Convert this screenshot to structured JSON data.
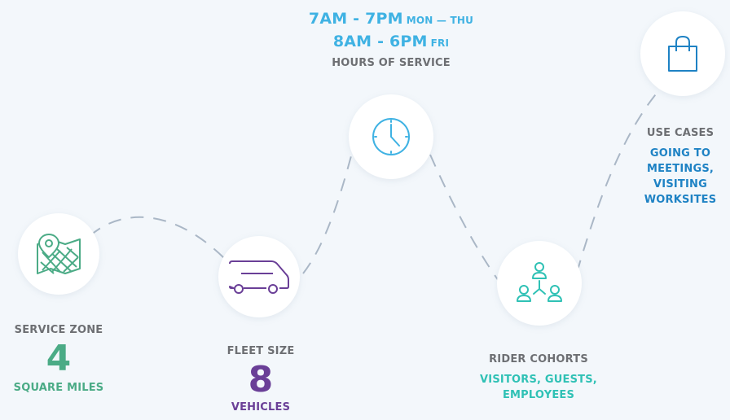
{
  "colors": {
    "path": "#aab7c6",
    "zone": "#4bab86",
    "fleet": "#6a3f97",
    "hours": "#3fb2e3",
    "cohorts": "#2fc1b5",
    "usecases": "#1e82c4",
    "caption": "#6d6f73"
  },
  "service_zone": {
    "icon": "map-pin-icon",
    "caption": "SERVICE ZONE",
    "value": "4",
    "unit": "SQUARE MILES"
  },
  "fleet_size": {
    "icon": "van-icon",
    "caption": "FLEET SIZE",
    "value": "8",
    "unit": "VEHICLES"
  },
  "hours_of_service": {
    "icon": "clock-icon",
    "line1_time": "7AM - 7PM",
    "line1_days": "MON — THU",
    "line2_time": "8AM - 6PM",
    "line2_days": "FRI",
    "caption": "HOURS OF SERVICE"
  },
  "rider_cohorts": {
    "icon": "people-network-icon",
    "caption": "RIDER COHORTS",
    "value_line1": "VISITORS, GUESTS,",
    "value_line2": "EMPLOYEES"
  },
  "use_cases": {
    "icon": "shopping-bag-icon",
    "caption": "USE CASES",
    "value_line1": "GOING TO",
    "value_line2": "MEETINGS,",
    "value_line3": "VISITING",
    "value_line4": "WORKSITES"
  }
}
